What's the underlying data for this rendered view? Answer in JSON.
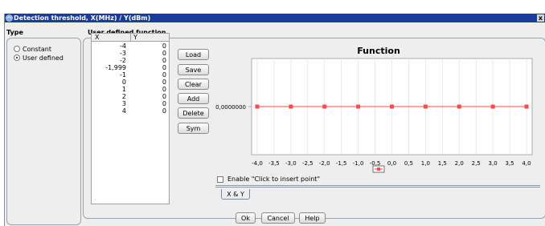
{
  "window": {
    "title": "Detection threshold, X(MHz) / Y(dBm)",
    "close_label": "x"
  },
  "type_group": {
    "label": "Type",
    "options": [
      {
        "label": "Constant",
        "selected": false
      },
      {
        "label": "User defined",
        "selected": true
      }
    ]
  },
  "function_group": {
    "label": "User defined function"
  },
  "table": {
    "columns": [
      "X",
      "Y"
    ],
    "rows": [
      {
        "x": "-4",
        "y": "0"
      },
      {
        "x": "-3",
        "y": "0"
      },
      {
        "x": "-2",
        "y": "0"
      },
      {
        "x": "-1,999",
        "y": "0"
      },
      {
        "x": "-1",
        "y": "0"
      },
      {
        "x": "0",
        "y": "0"
      },
      {
        "x": "1",
        "y": "0"
      },
      {
        "x": "2",
        "y": "0"
      },
      {
        "x": "3",
        "y": "0"
      },
      {
        "x": "4",
        "y": "0"
      }
    ]
  },
  "side_buttons": {
    "load": "Load",
    "save": "Save",
    "clear": "Clear",
    "add": "Add",
    "delete": "Delete",
    "sym": "Sym"
  },
  "chart_data": {
    "type": "line",
    "title": "Function",
    "xlabel": "",
    "ylabel": "",
    "x_ticks": [
      "-4,0",
      "-3,5",
      "-3,0",
      "-2,5",
      "-2,0",
      "-1,5",
      "-1,0",
      "-0,5",
      "0,0",
      "0,5",
      "1,0",
      "1,5",
      "2,0",
      "2,5",
      "3,0",
      "3,5",
      "4,0"
    ],
    "y_ticks": [
      "0,0000000"
    ],
    "xlim": [
      -4,
      4
    ],
    "grid": true,
    "legend_position": "bottom",
    "color": "#ff4a4a",
    "series": [
      {
        "x": [
          -4,
          -3,
          -2,
          -1,
          0,
          1,
          2,
          3,
          4
        ],
        "y": [
          0,
          0,
          0,
          0,
          0,
          0,
          0,
          0,
          0
        ]
      }
    ]
  },
  "enable_click_insert": {
    "label": "Enable \"Click to insert point\"",
    "checked": false
  },
  "tab": {
    "label": "X & Y"
  },
  "bottom_buttons": {
    "ok": "Ok",
    "cancel": "Cancel",
    "help": "Help"
  }
}
